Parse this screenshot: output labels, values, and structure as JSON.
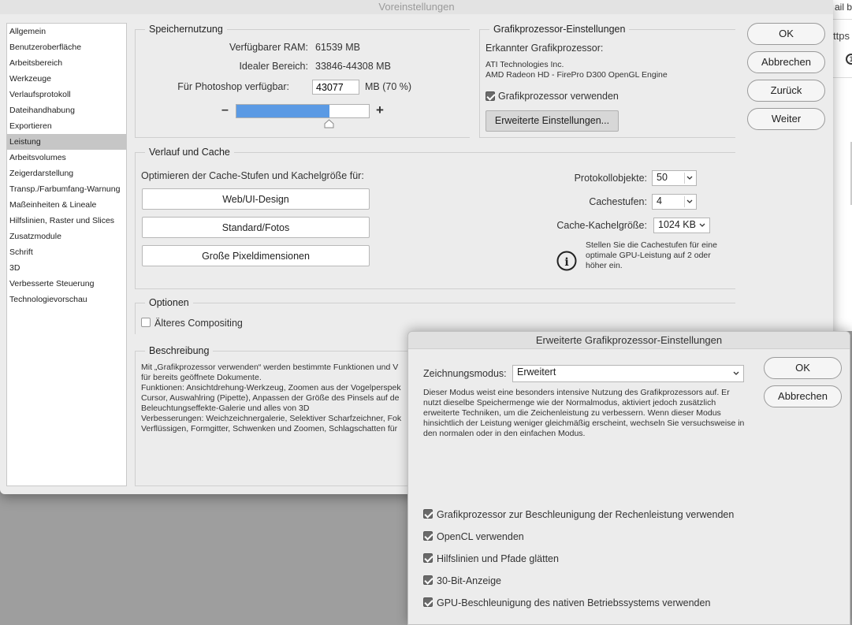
{
  "window_title": "Voreinstellungen",
  "bg_app": {
    "text1": "ail be",
    "text2": "ttps",
    "icon": "1"
  },
  "sidebar": {
    "items": [
      {
        "label": "Allgemein"
      },
      {
        "label": "Benutzeroberfläche"
      },
      {
        "label": "Arbeitsbereich"
      },
      {
        "label": "Werkzeuge"
      },
      {
        "label": "Verlaufsprotokoll"
      },
      {
        "label": "Dateihandhabung"
      },
      {
        "label": "Exportieren"
      },
      {
        "label": "Leistung"
      },
      {
        "label": "Arbeitsvolumes"
      },
      {
        "label": "Zeigerdarstellung"
      },
      {
        "label": "Transp./Farbumfang-Warnung"
      },
      {
        "label": "Maßeinheiten & Lineale"
      },
      {
        "label": "Hilfslinien, Raster und Slices"
      },
      {
        "label": "Zusatzmodule"
      },
      {
        "label": "Schrift"
      },
      {
        "label": "3D"
      },
      {
        "label": "Verbesserte Steuerung"
      },
      {
        "label": "Technologievorschau"
      }
    ],
    "active_index": 7
  },
  "memory": {
    "title": "Speichernutzung",
    "ram_label": "Verfügbarer RAM:",
    "ram_value": "61539 MB",
    "ideal_label": "Idealer Bereich:",
    "ideal_value": "33846-44308 MB",
    "ps_label": "Für Photoshop verfügbar:",
    "ps_value": "43077",
    "ps_unit": "MB (70 %)",
    "minus": "–",
    "plus": "+",
    "slider_fraction": 0.7
  },
  "gpu": {
    "title": "Grafikprozessor-Einstellungen",
    "detected_label": "Erkannter Grafikprozessor:",
    "vendor": "ATI Technologies Inc.",
    "renderer": "AMD Radeon HD - FirePro D300 OpenGL Engine",
    "use_gpu_label": "Grafikprozessor verwenden",
    "use_gpu_checked": true,
    "advanced_button": "Erweiterte Einstellungen..."
  },
  "buttons": {
    "ok": "OK",
    "cancel": "Abbrechen",
    "back": "Zurück",
    "next": "Weiter"
  },
  "cache": {
    "title": "Verlauf und Cache",
    "optimize_label": "Optimieren der Cache-Stufen und Kachelgröße für:",
    "preset_web": "Web/UI-Design",
    "preset_standard": "Standard/Fotos",
    "preset_large": "Große Pixeldimensionen",
    "history_label": "Protokollobjekte:",
    "history_value": "50",
    "levels_label": "Cachestufen:",
    "levels_value": "4",
    "tile_label": "Cache-Kachelgröße:",
    "tile_value": "1024 KB",
    "info_text": "Stellen Sie die Cachestufen für eine optimale GPU-Leistung auf 2 oder höher ein.",
    "info_icon": "i"
  },
  "options": {
    "title": "Optionen",
    "legacy_compositing": "Älteres Compositing",
    "legacy_checked": false
  },
  "description": {
    "title": "Beschreibung",
    "lines": [
      "Mit „Grafikprozessor verwenden“ werden bestimmte Funktionen und V",
      "für bereits geöffnete Dokumente.",
      "Funktionen: Ansichtdrehung-Werkzeug, Zoomen aus der Vogelperspek",
      "Cursor, Auswahlring (Pipette), Anpassen der Größe des Pinsels auf de",
      "Beleuchtungseffekte-Galerie und alles von 3D",
      "Verbesserungen: Weichzeichnergalerie, Selektiver Scharfzeichner, Fok",
      "Verflüssigen, Formgitter, Schwenken und Zoomen, Schlagschatten für"
    ]
  },
  "advanced": {
    "title": "Erweiterte Grafikprozessor-Einstellungen",
    "mode_label": "Zeichnungsmodus:",
    "mode_value": "Erweitert",
    "mode_description": "Dieser Modus weist eine besonders intensive Nutzung des Grafikprozessors auf. Er nutzt dieselbe Speichermenge wie der Normalmodus, aktiviert jedoch zusätzlich erweiterte Techniken, um die Zeichenleistung zu verbessern. Wenn dieser Modus hinsichtlich der Leistung weniger gleichmäßig erscheint, wechseln Sie versuchsweise in den normalen oder in den einfachen Modus.",
    "ok": "OK",
    "cancel": "Abbrechen",
    "checkboxes": [
      {
        "label": "Grafikprozessor zur Beschleunigung der Rechenleistung verwenden",
        "checked": true
      },
      {
        "label": "OpenCL verwenden",
        "checked": true
      },
      {
        "label": "Hilfslinien und Pfade glätten",
        "checked": true
      },
      {
        "label": "30-Bit-Anzeige",
        "checked": true
      },
      {
        "label": "GPU-Beschleunigung des nativen Betriebssystems verwenden",
        "checked": true
      }
    ]
  }
}
